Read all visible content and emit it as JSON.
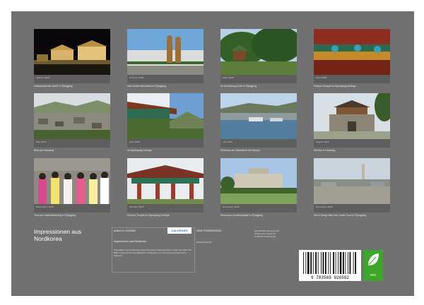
{
  "calendar": {
    "title_line1": "Impressionen aus",
    "title_line2": "Nordkorea"
  },
  "photos": [
    {
      "caption": "Kulturpalast bei Nacht in Pjöngjang",
      "date_strip": "Januar 2025"
    },
    {
      "caption": "Das Große Monument in Pjöngjang",
      "date_strip": "Februar 2025"
    },
    {
      "caption": "Im Moranbong-Park in Pjöngjang",
      "date_strip": "März 2025"
    },
    {
      "caption": "Pohyon-Tempel im Myohyang-Gebirge",
      "date_strip": "April 2025"
    },
    {
      "caption": "Blick auf Kaesong",
      "date_strip": "Mai 2025"
    },
    {
      "caption": "Im Myohyang-Gebirge",
      "date_strip": "Juni 2025"
    },
    {
      "caption": "Schleuse am Staudamm bei Nampo",
      "date_strip": "Juli 2025"
    },
    {
      "caption": "Nordtor in Kaesong",
      "date_strip": "August 2025"
    },
    {
      "caption": "Tanz am Nationalfeiertag in Pjöngjang",
      "date_strip": "September 2025"
    },
    {
      "caption": "Pohyon-Tempel im Myohyang-Gebirge",
      "date_strip": "Oktober 2025"
    },
    {
      "caption": "Kumsusan-Gedenkpalast in Pjöngjang",
      "date_strip": "November 2025"
    },
    {
      "caption": "Kim-Il-Sung-Platz und Juche-Turm in Pjöngjang",
      "date_strip": "Dezember 2025"
    }
  ],
  "info": {
    "article_no": "Artikel-Nr. 2430683",
    "calendar_name": "Impressionen aus Nordkorea",
    "description": "Fotografien aus Nordkorea, einem der letzten abgeschotteten Länder der Welt. Die Bilder zeigen Sehenswürdigkeiten in Pjöngjang, im Myohyang-Gebirge und in Kaesong.",
    "isbn": "ISBN 9783569926592",
    "author": "Gabriel Swenkis",
    "publisher_name": "CALVENDO Verlag GmbH",
    "publisher_street": "Ottobrunner Straße 39",
    "publisher_city": "D-82008 Unterhaching",
    "calvendo_logo": "CALVENDO",
    "barcode_digits": "9 783569 926592",
    "eco_label": "eco"
  },
  "colors": {
    "page_bg": "#717171",
    "eco_green": "#3ea62b"
  }
}
